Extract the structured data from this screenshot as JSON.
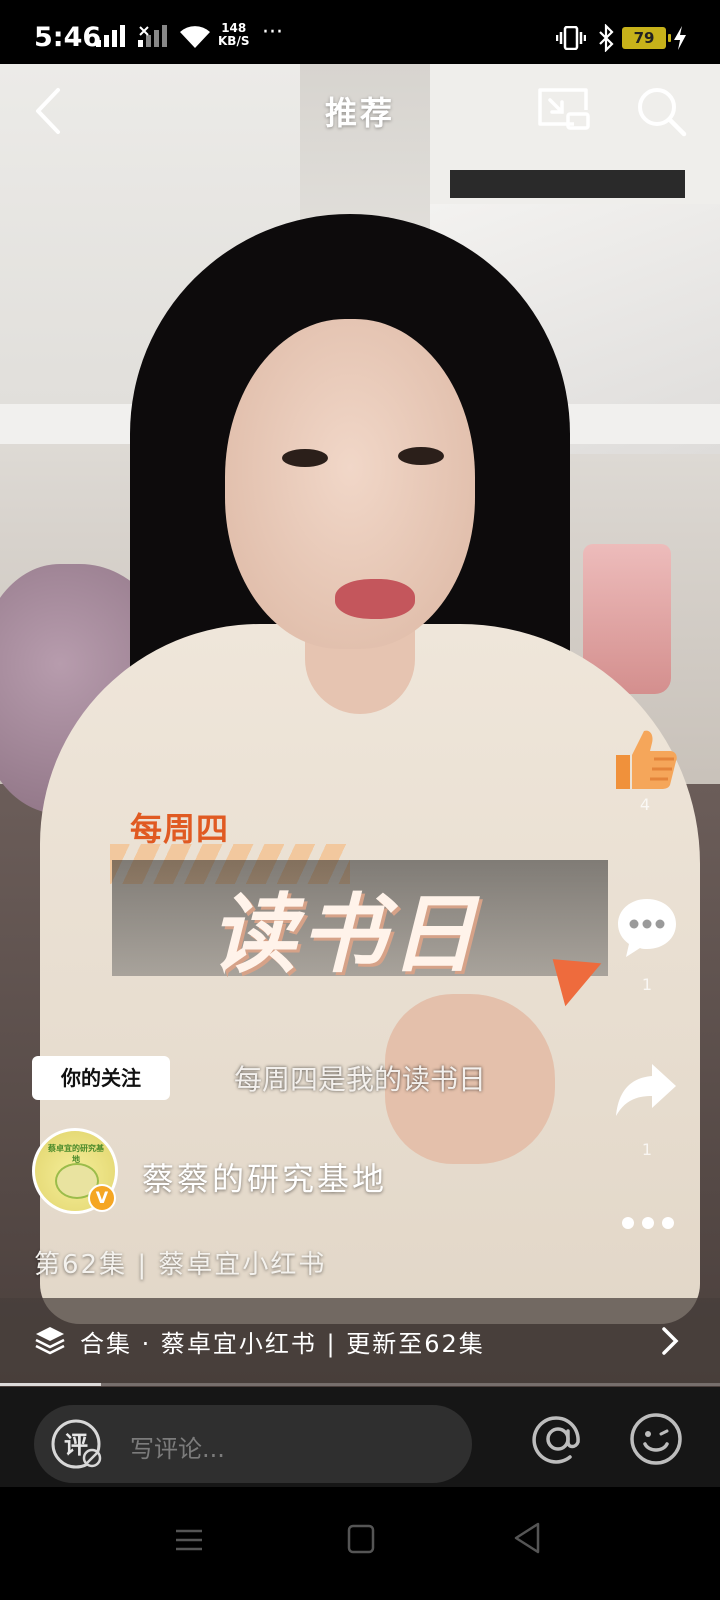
{
  "status_bar": {
    "time": "5:46",
    "net_speed_value": "148",
    "net_speed_unit": "KB/S",
    "more": "···",
    "battery": "79"
  },
  "nav": {
    "title": "推荐"
  },
  "video": {
    "overlay_week": "每周四",
    "overlay_title": "读书日",
    "subtitle": "每周四是我的读书日"
  },
  "actions": {
    "like_count": "4",
    "comment_count": "1",
    "share_count": "1"
  },
  "author": {
    "follow_tag": "你的关注",
    "avatar_text": "蔡卓宜的研究基地",
    "name": "蔡蔡的研究基地",
    "verified_mark": "V"
  },
  "episode": "第62集 | 蔡卓宜小红书",
  "collection": {
    "text": "合集 · 蔡卓宜小红书 | 更新至62集"
  },
  "playback_progress_percent": 14,
  "comment_bar": {
    "placeholder": "写评论..."
  },
  "colors": {
    "accent_orange": "#ee6b3d",
    "battery": "#c7b21a",
    "verified": "#f5a623"
  }
}
